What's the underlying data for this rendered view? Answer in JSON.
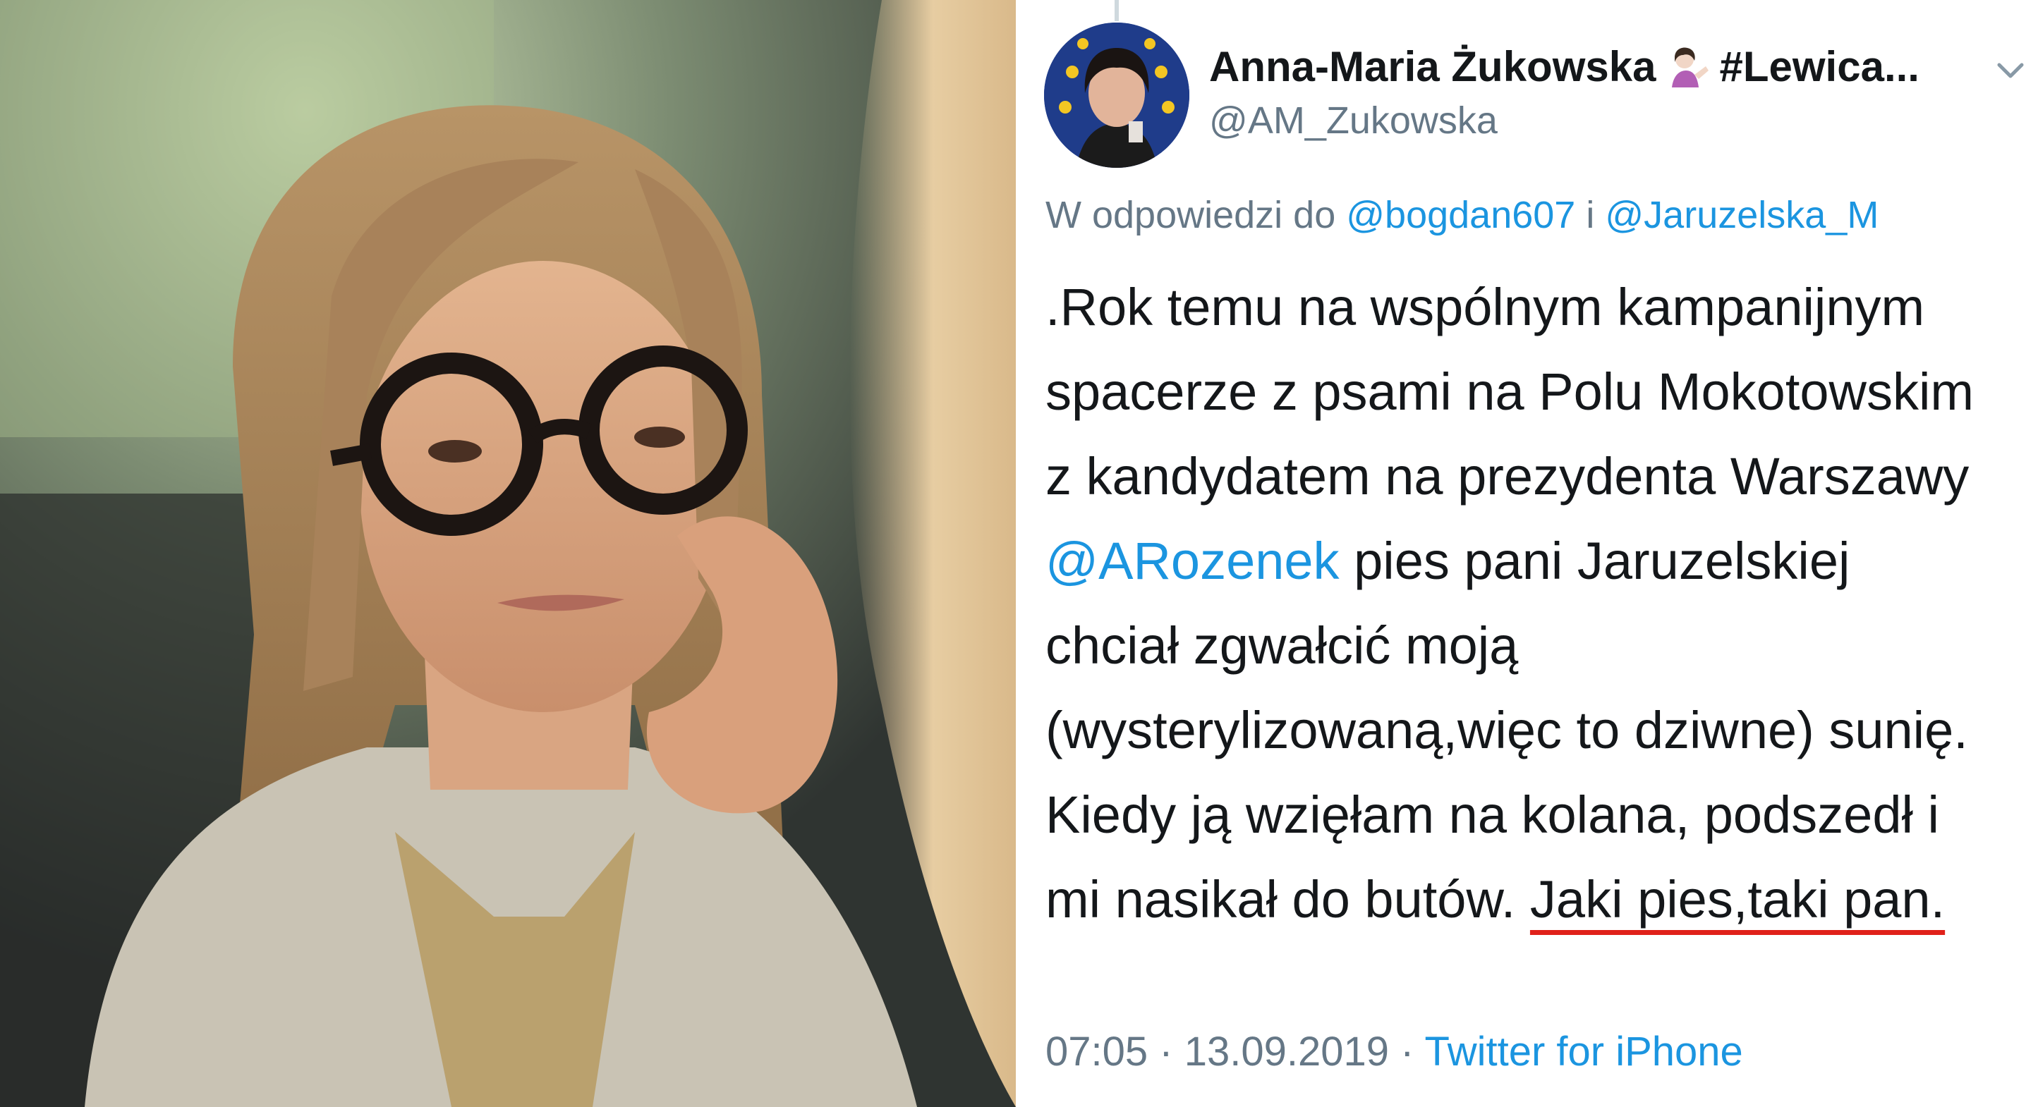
{
  "photo": {
    "subject": "portrait photo"
  },
  "tweet": {
    "author": {
      "display_name": "Anna-Maria Żukowska",
      "name_suffix": "#Lewica...",
      "handle": "@AM_Zukowska"
    },
    "reply_to": {
      "prefix": "W odpowiedzi do ",
      "user1": "@bogdan607",
      "joiner": " i ",
      "user2": "@Jaruzelska_M"
    },
    "body": {
      "line1": ".Rok temu na wspólnym kampanijnym",
      "line2": "spacerze z psami na Polu Mokotowskim",
      "line3": "z kandydatem na prezydenta Warszawy",
      "line4_mention": "@ARozenek",
      "line4_rest": " pies pani Jaruzelskiej",
      "line5": "chciał zgwałcić moją",
      "line6": "(wysterylizowaną,więc to dziwne) sunię.",
      "line7": "Kiedy ją wzięłam na kolana, podszedł i",
      "line8_plain": "mi nasikał do butów. ",
      "line8_underlined": "Jaki pies,taki pan."
    },
    "meta": {
      "time": "07:05",
      "separator1": " · ",
      "date": "13.09.2019",
      "separator2": " · ",
      "source": "Twitter for iPhone"
    },
    "colors": {
      "link": "#1b95e0",
      "secondary_text": "#657786",
      "primary_text": "#14171a",
      "underline": "#e0211a"
    },
    "icons": {
      "menu": "chevron-down-icon",
      "emoji": "person-tipping-hand-emoji"
    }
  }
}
